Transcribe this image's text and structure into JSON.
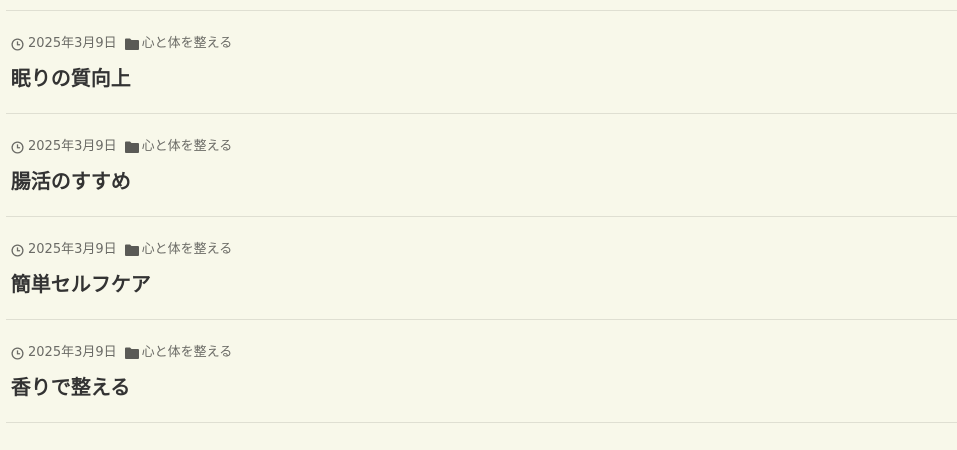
{
  "posts": [
    {
      "date": "2025年3月9日",
      "category": "心と体を整える",
      "title": "眠りの質向上"
    },
    {
      "date": "2025年3月9日",
      "category": "心と体を整える",
      "title": "腸活のすすめ"
    },
    {
      "date": "2025年3月9日",
      "category": "心と体を整える",
      "title": "簡単セルフケア"
    },
    {
      "date": "2025年3月9日",
      "category": "心と体を整える",
      "title": "香りで整える"
    }
  ],
  "icons": {
    "date": "clock-icon",
    "category": "folder-icon"
  },
  "colors": {
    "background": "#f8f8ea",
    "meta_text": "#6b6b66",
    "title_text": "#333333",
    "divider": "#dfdfd2"
  }
}
